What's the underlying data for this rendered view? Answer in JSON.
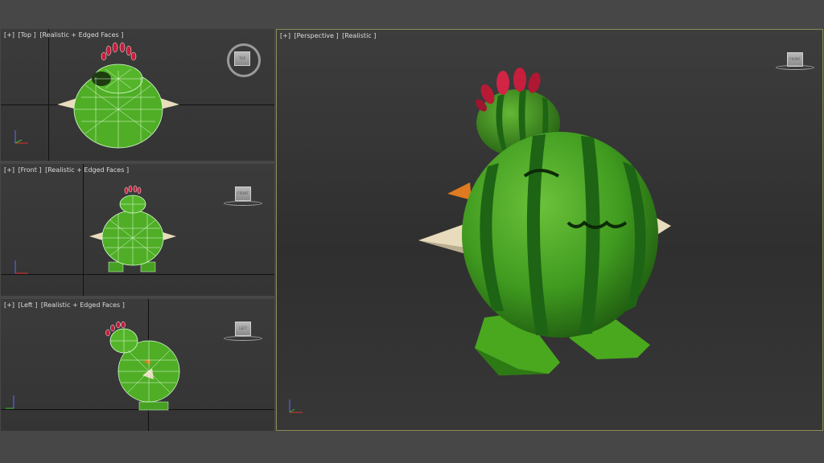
{
  "viewports": {
    "top": {
      "plus": "[+]",
      "view": "[Top ]",
      "mode": "[Realistic + Edged Faces ]",
      "cube": "TOP"
    },
    "front": {
      "plus": "[+]",
      "view": "[Front ]",
      "mode": "[Realistic + Edged Faces ]",
      "cube": "FRONT"
    },
    "left": {
      "plus": "[+]",
      "view": "[Left ]",
      "mode": "[Realistic + Edged Faces ]",
      "cube": "LEFT"
    },
    "perspective": {
      "plus": "[+]",
      "view": "[Perspective ]",
      "mode": "[Realistic ]",
      "cube": "FRONT"
    }
  },
  "axes": {
    "x": "x",
    "y": "y",
    "z": "z"
  },
  "colors": {
    "melon_green": "#3f9a1f",
    "stripe_dark": "#1c5c12",
    "flower_red": "#c21e3a",
    "spike": "#e8dcbc",
    "beak": "#e07a20"
  }
}
